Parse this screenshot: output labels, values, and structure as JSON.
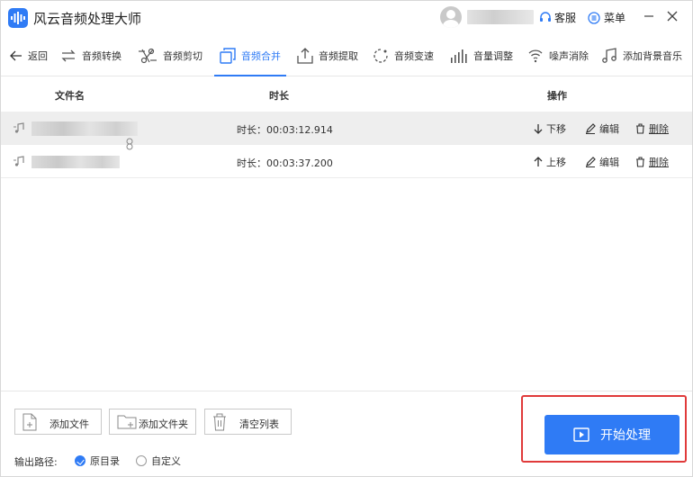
{
  "app": {
    "title": "风云音频处理大师"
  },
  "header": {
    "service_label": "客服",
    "menu_label": "菜单"
  },
  "toolbar": {
    "back_label": "返回",
    "tools": [
      {
        "label": "音频转换",
        "icon": "convert-icon"
      },
      {
        "label": "音频剪切",
        "icon": "scissors-icon"
      },
      {
        "label": "音频合并",
        "icon": "merge-icon",
        "active": true
      },
      {
        "label": "音频提取",
        "icon": "extract-icon"
      },
      {
        "label": "音频变速",
        "icon": "speed-icon"
      },
      {
        "label": "音量调整",
        "icon": "volume-bars-icon"
      },
      {
        "label": "噪声消除",
        "icon": "noise-icon"
      },
      {
        "label": "添加背景音乐",
        "icon": "music-note-icon"
      }
    ]
  },
  "table": {
    "headers": {
      "name": "文件名",
      "duration": "时长",
      "action": "操作"
    },
    "rows": [
      {
        "duration": "时长：00:03:12.914",
        "move_label": "下移",
        "edit_label": "编辑",
        "delete_label": "删除"
      },
      {
        "duration": "时长：00:03:37.200",
        "move_label": "上移",
        "edit_label": "编辑",
        "delete_label": "删除"
      }
    ]
  },
  "bottom": {
    "add_file_label": "添加文件",
    "add_folder_label": "添加文件夹",
    "clear_list_label": "清空列表",
    "output_path_label": "输出路径:",
    "options": [
      {
        "label": "原目录",
        "selected": true
      },
      {
        "label": "自定义",
        "selected": false
      }
    ],
    "start_label": "开始处理"
  },
  "colors": {
    "accent": "#2f7bf5",
    "highlight": "#e03a3a"
  }
}
